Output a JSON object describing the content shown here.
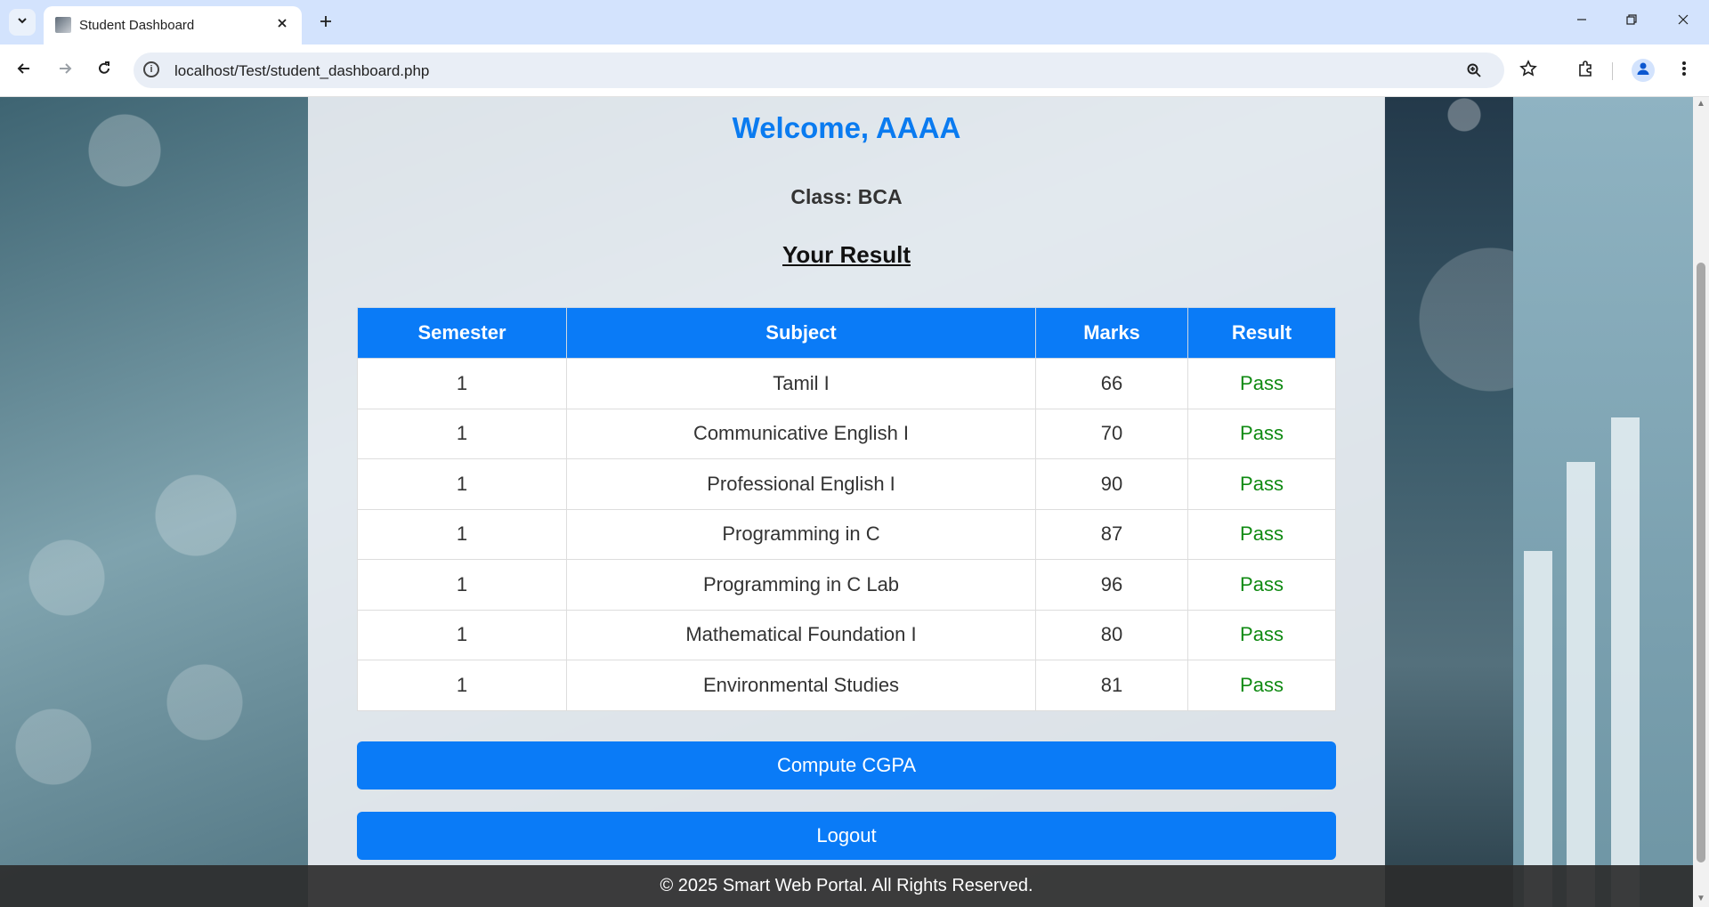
{
  "browser": {
    "tab_title": "Student Dashboard",
    "url": "localhost/Test/student_dashboard.php"
  },
  "page": {
    "welcome": "Welcome, AAAA",
    "class_line": "Class: BCA",
    "result_heading": "Your Result",
    "table": {
      "headers": [
        "Semester",
        "Subject",
        "Marks",
        "Result"
      ],
      "rows": [
        {
          "semester": "1",
          "subject": "Tamil I",
          "marks": "66",
          "result": "Pass"
        },
        {
          "semester": "1",
          "subject": "Communicative English I",
          "marks": "70",
          "result": "Pass"
        },
        {
          "semester": "1",
          "subject": "Professional English I",
          "marks": "90",
          "result": "Pass"
        },
        {
          "semester": "1",
          "subject": "Programming in C",
          "marks": "87",
          "result": "Pass"
        },
        {
          "semester": "1",
          "subject": "Programming in C Lab",
          "marks": "96",
          "result": "Pass"
        },
        {
          "semester": "1",
          "subject": "Mathematical Foundation I",
          "marks": "80",
          "result": "Pass"
        },
        {
          "semester": "1",
          "subject": "Environmental Studies",
          "marks": "81",
          "result": "Pass"
        }
      ]
    },
    "buttons": {
      "compute": "Compute CGPA",
      "logout": "Logout"
    },
    "footer": "© 2025 Smart Web Portal. All Rights Reserved."
  },
  "colors": {
    "accent_blue": "#0a7bf7",
    "welcome_blue": "#0a7bf0",
    "pass_green": "#0f8a12"
  }
}
